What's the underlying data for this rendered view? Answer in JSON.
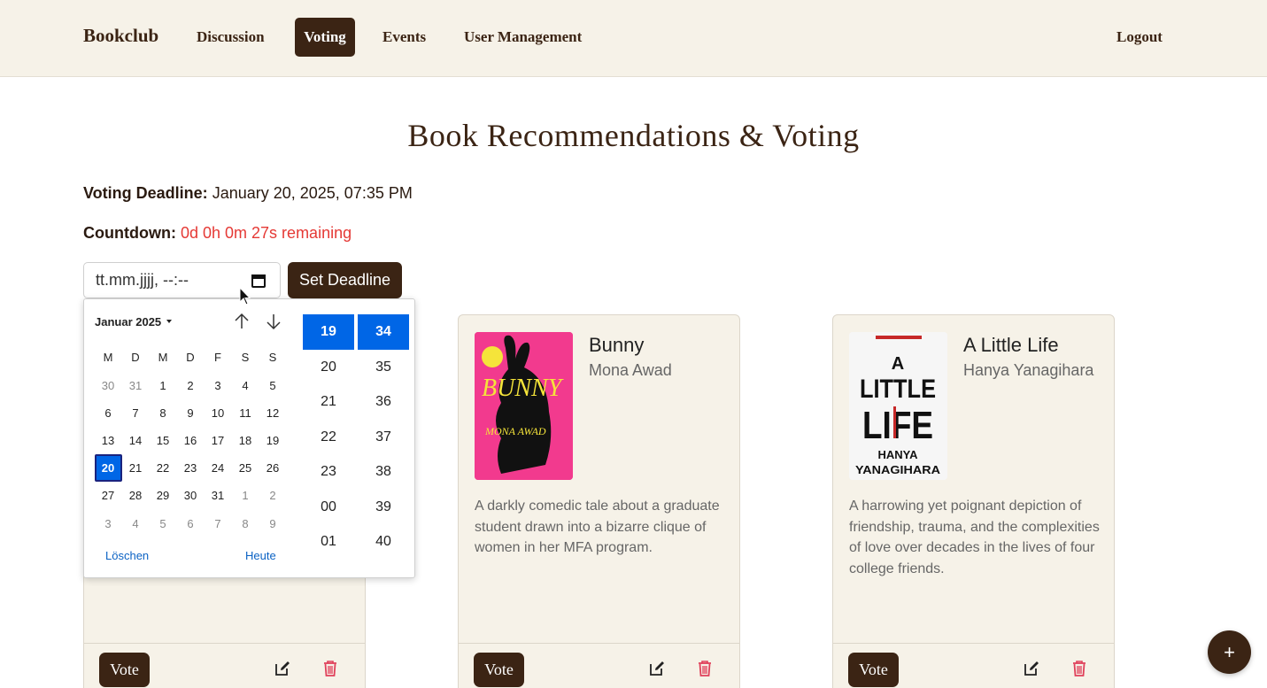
{
  "nav": {
    "brand": "Bookclub",
    "items": [
      "Discussion",
      "Voting",
      "Events",
      "User Management"
    ],
    "active": "Voting",
    "logout": "Logout"
  },
  "page": {
    "title": "Book Recommendations & Voting",
    "deadline_label": "Voting Deadline:",
    "deadline_value": "January 20, 2025, 07:35 PM",
    "countdown_label": "Countdown:",
    "countdown_value": "0d 0h 0m 27s remaining",
    "datetime_placeholder": "tt.mm.jjjj, --:--",
    "set_deadline": "Set Deadline"
  },
  "picker": {
    "month": "Januar 2025",
    "weekdays": [
      "M",
      "D",
      "M",
      "D",
      "F",
      "S",
      "S"
    ],
    "weeks": [
      [
        [
          "30",
          true
        ],
        [
          "31",
          true
        ],
        [
          "1",
          false
        ],
        [
          "2",
          false
        ],
        [
          "3",
          false
        ],
        [
          "4",
          false
        ],
        [
          "5",
          false
        ]
      ],
      [
        [
          "6",
          false
        ],
        [
          "7",
          false
        ],
        [
          "8",
          false
        ],
        [
          "9",
          false
        ],
        [
          "10",
          false
        ],
        [
          "11",
          false
        ],
        [
          "12",
          false
        ]
      ],
      [
        [
          "13",
          false
        ],
        [
          "14",
          false
        ],
        [
          "15",
          false
        ],
        [
          "16",
          false
        ],
        [
          "17",
          false
        ],
        [
          "18",
          false
        ],
        [
          "19",
          false
        ]
      ],
      [
        [
          "20",
          false
        ],
        [
          "21",
          false
        ],
        [
          "22",
          false
        ],
        [
          "23",
          false
        ],
        [
          "24",
          false
        ],
        [
          "25",
          false
        ],
        [
          "26",
          false
        ]
      ],
      [
        [
          "27",
          false
        ],
        [
          "28",
          false
        ],
        [
          "29",
          false
        ],
        [
          "30",
          false
        ],
        [
          "31",
          false
        ],
        [
          "1",
          true
        ],
        [
          "2",
          true
        ]
      ],
      [
        [
          "3",
          true
        ],
        [
          "4",
          true
        ],
        [
          "5",
          true
        ],
        [
          "6",
          true
        ],
        [
          "7",
          true
        ],
        [
          "8",
          true
        ],
        [
          "9",
          true
        ]
      ]
    ],
    "selected_day": "20",
    "clear": "Löschen",
    "today": "Heute",
    "hours": [
      "19",
      "20",
      "21",
      "22",
      "23",
      "00",
      "01"
    ],
    "minutes": [
      "34",
      "35",
      "36",
      "37",
      "38",
      "39",
      "40"
    ],
    "selected_hour": "19",
    "selected_minute": "34"
  },
  "cards": [
    {
      "title": "",
      "author": "",
      "description": "",
      "vote": "Vote"
    },
    {
      "title": "Bunny",
      "author": "Mona Awad",
      "description": "A darkly comedic tale about a graduate student drawn into a bizarre clique of women in her MFA program.",
      "vote": "Vote",
      "cover_text": "BUNNY",
      "cover_subtext": "MONA AWAD"
    },
    {
      "title": "A Little Life",
      "author": "Hanya Yanagihara",
      "description": "A harrowing yet poignant depiction of friendship, trauma, and the complexities of love over decades in the lives of four college friends.",
      "vote": "Vote",
      "cover_text": "A LITTLE LIFE",
      "cover_subtext": "HANYA YANAGIHARA"
    }
  ],
  "fab": {
    "label": "+"
  },
  "colors": {
    "brand": "#3b2414",
    "nav_bg": "#f6f2e8",
    "card_bg": "#f6f2e8",
    "countdown": "#e53935",
    "picker_selected": "#0066e6",
    "delete": "#e0405a"
  }
}
